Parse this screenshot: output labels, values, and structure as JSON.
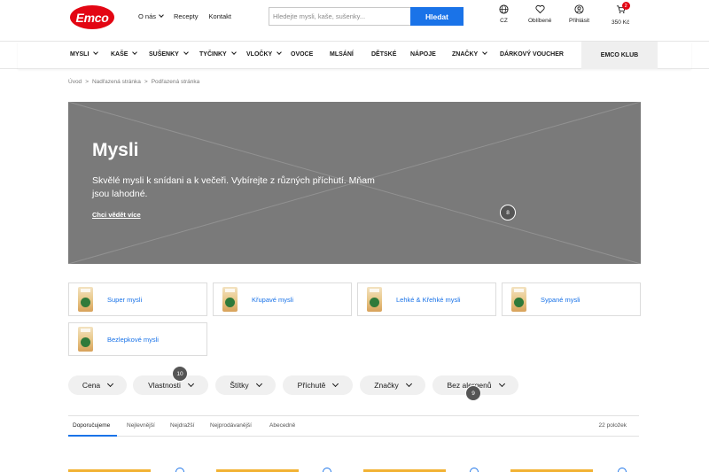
{
  "header": {
    "logo": "Emco",
    "links": [
      "O nás",
      "Recepty",
      "Kontakt"
    ],
    "search_placeholder": "Hledejte mysli, kaše, sušenky...",
    "search_button": "Hledat",
    "lang": "CZ",
    "favorites": "Oblíbené",
    "login": "Přihlásit",
    "cart_total": "350 Kč",
    "cart_count": "2"
  },
  "nav": {
    "items": [
      "MYSLI",
      "KAŠE",
      "SUŠENKY",
      "TYČINKY",
      "VLOČKY",
      "OVOCE",
      "MLSÁNÍ",
      "DĚTSKÉ",
      "NÁPOJE",
      "ZNAČKY",
      "DÁRKOVÝ VOUCHER"
    ],
    "club": "EMCO KLUB"
  },
  "breadcrumb": [
    "Úvod",
    ">",
    "Nadřazená stránka",
    ">",
    "Podřazená stránka"
  ],
  "hero": {
    "title": "Mysli",
    "text": "Skvělé mysli k snídani a k večeři. Vybírejte z různých příchutí. Mňam jsou lahodné.",
    "link": "Chci vědět více",
    "marker": "8"
  },
  "categories": [
    "Super mysli",
    "Křupavé mysli",
    "Lehké & Křehké mysli",
    "Sypané mysli",
    "Bezlepkové mysli"
  ],
  "filters": [
    "Cena",
    "Vlastnosti",
    "Štítky",
    "Příchutě",
    "Značky",
    "Bez alergenů"
  ],
  "markers": {
    "properties": "10",
    "allergens": "9"
  },
  "sort_tabs": [
    "Doporučujeme",
    "Nejlevnější",
    "Nejdražší",
    "Nejprodávanější",
    "Abecedně"
  ],
  "item_count": "22 položek",
  "colors": {
    "brand_red": "#e30613",
    "accent_blue": "#1a73e8",
    "hero_gray": "#7a7a7a",
    "badge_yellow": "#f2b233"
  }
}
